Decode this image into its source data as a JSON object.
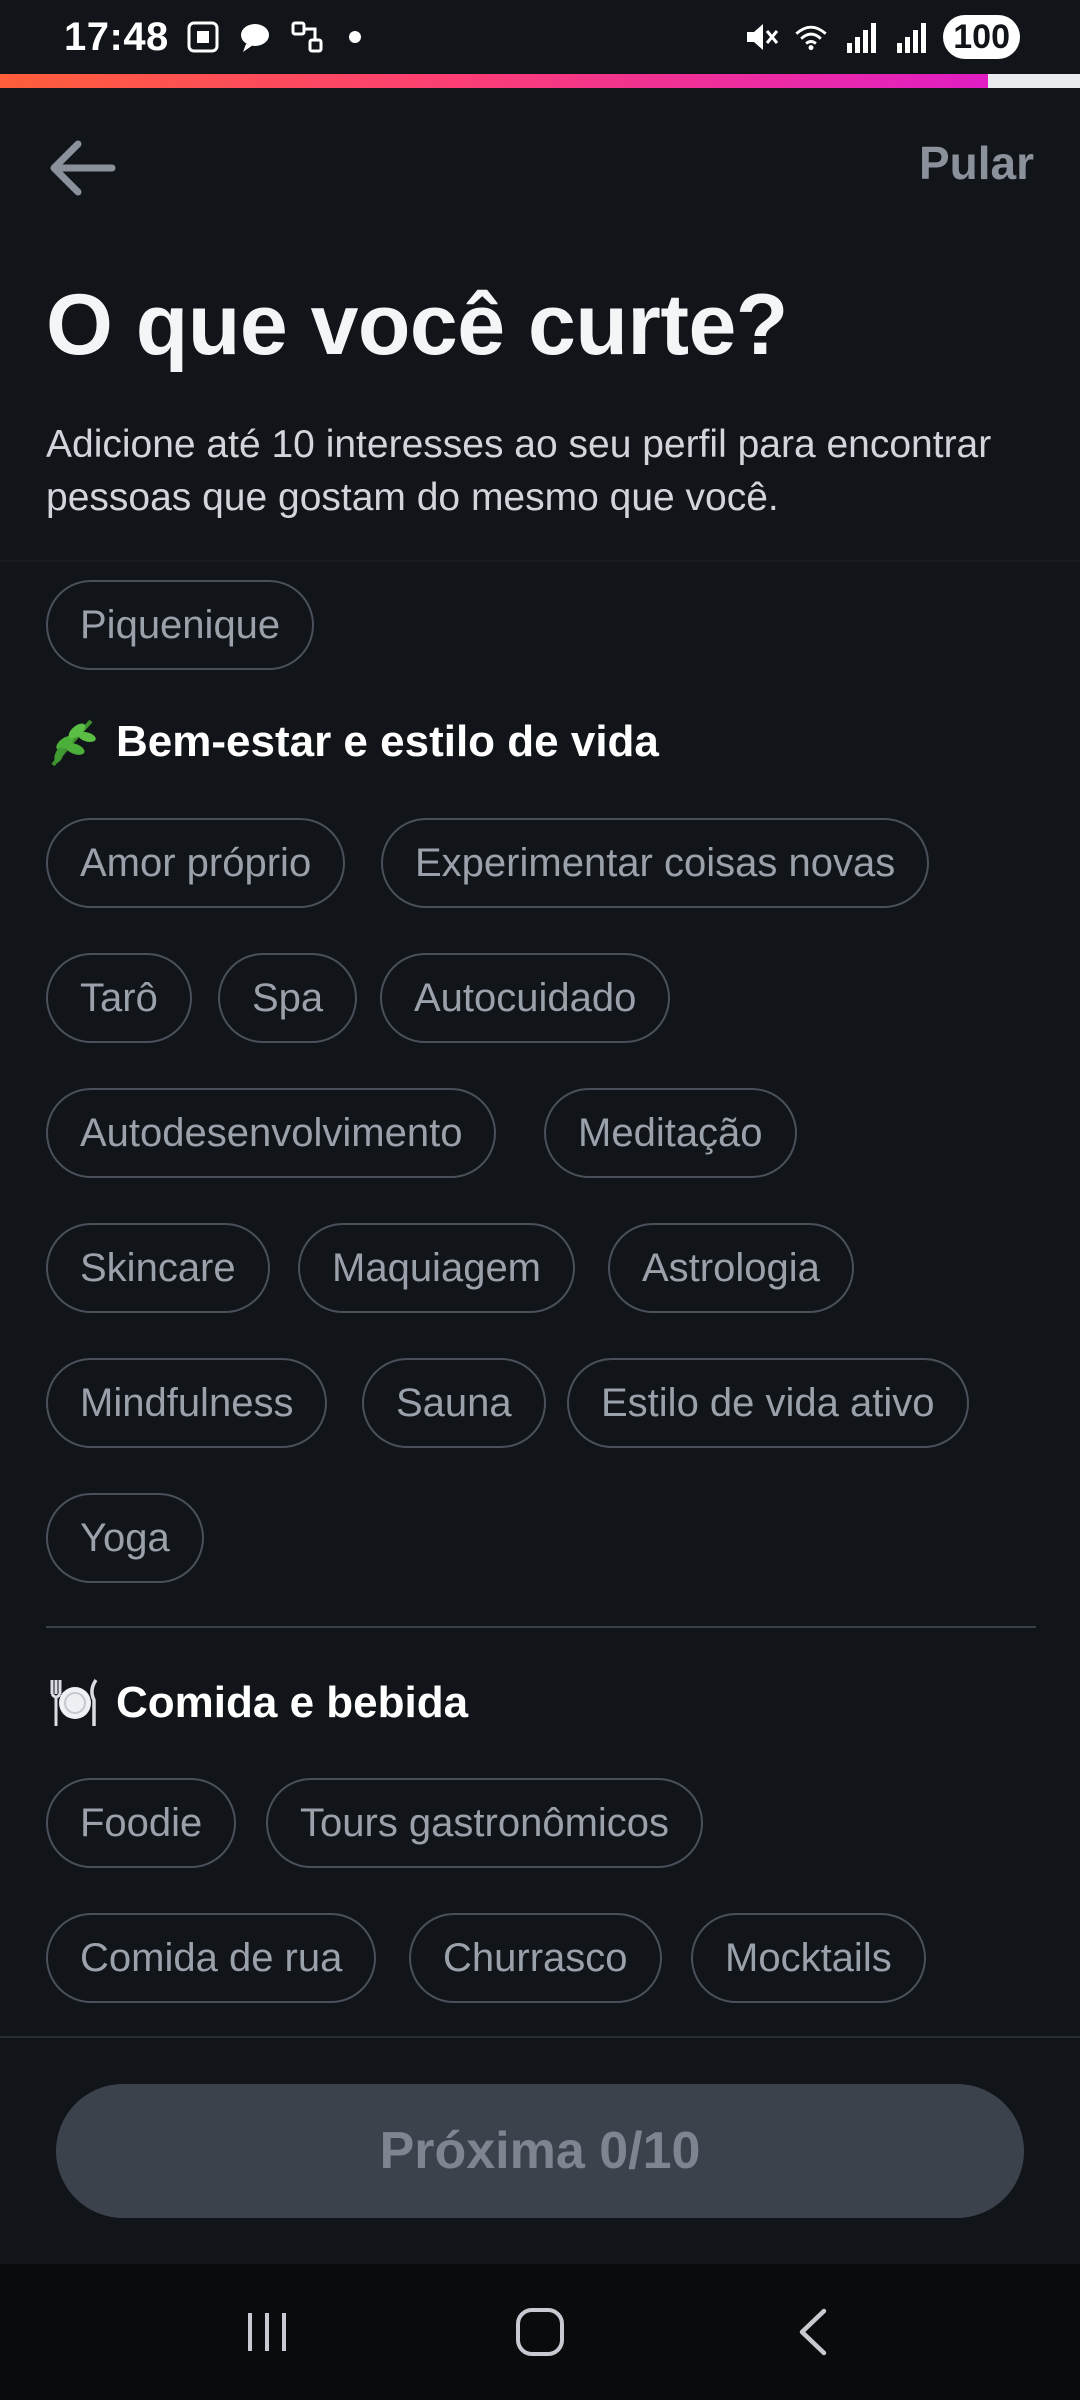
{
  "status_bar": {
    "time": "17:48",
    "battery": "100",
    "icons": [
      "screenshot-icon",
      "message-icon",
      "link-icon",
      "mute-icon",
      "wifi-icon",
      "signal-icon"
    ]
  },
  "progress": {
    "fraction": 0.915,
    "colors": [
      "#fd5e3a",
      "#fc3f73",
      "#e11ec4"
    ]
  },
  "nav": {
    "skip_label": "Pular"
  },
  "header": {
    "title": "O que você curte?",
    "subtitle": "Adicione até 10 interesses ao seu perfil para encontrar pessoas que gostam do mesmo que você."
  },
  "chips_top": [
    "Piquenique"
  ],
  "sections": [
    {
      "icon": "herb-icon",
      "title": "Bem-estar e estilo de vida",
      "chips": [
        "Amor próprio",
        "Experimentar coisas novas",
        "Tarô",
        "Spa",
        "Autocuidado",
        "Autodesenvolvimento",
        "Meditação",
        "Skincare",
        "Maquiagem",
        "Astrologia",
        "Mindfulness",
        "Sauna",
        "Estilo de vida ativo",
        "Yoga"
      ]
    },
    {
      "icon": "plate-icon",
      "title": "Comida e bebida",
      "chips": [
        "Foodie",
        "Tours gastronômicos",
        "Comida de rua",
        "Churrasco",
        "Mocktails"
      ]
    }
  ],
  "footer": {
    "next_label": "Próxima 0/10"
  },
  "system_nav": [
    "recent-apps-icon",
    "home-icon",
    "back-nav-icon"
  ]
}
